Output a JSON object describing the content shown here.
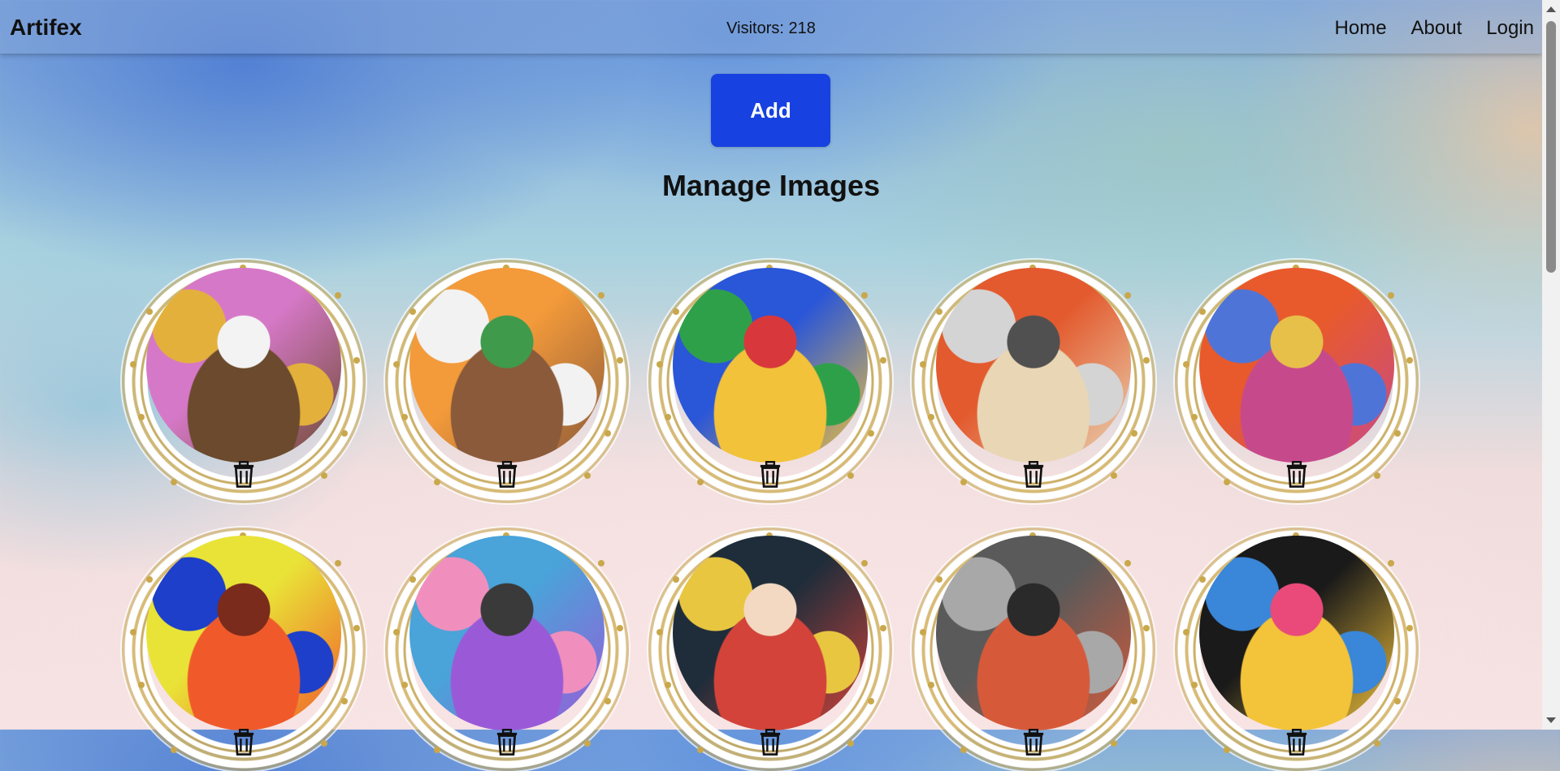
{
  "navbar": {
    "brand": "Artifex",
    "visitors": "Visitors: 218",
    "links": [
      "Home",
      "About",
      "Login"
    ]
  },
  "actions": {
    "add_label": "Add"
  },
  "page": {
    "title": "Manage Images"
  },
  "gallery": {
    "items": [
      {
        "icon": "delete-icon",
        "palette": [
          "#d678c8",
          "#e3b13b",
          "#f3f3f3",
          "#6b4a2d"
        ]
      },
      {
        "icon": "delete-icon",
        "palette": [
          "#f39a3a",
          "#f2f2f2",
          "#3f9a4c",
          "#8a5a3a"
        ]
      },
      {
        "icon": "delete-icon",
        "palette": [
          "#2a56d8",
          "#2fa04a",
          "#d8383b",
          "#f2c23a"
        ]
      },
      {
        "icon": "delete-icon",
        "palette": [
          "#e35a2e",
          "#d4d4d4",
          "#505050",
          "#e9d6b5"
        ]
      },
      {
        "icon": "delete-icon",
        "palette": [
          "#e85a2c",
          "#4f74d8",
          "#e7c04a",
          "#c64a8b"
        ]
      },
      {
        "icon": "delete-icon",
        "palette": [
          "#e9e337",
          "#1e3fc9",
          "#7a2b1c",
          "#f05a2a"
        ]
      },
      {
        "icon": "delete-icon",
        "palette": [
          "#4aa3d9",
          "#f08fbd",
          "#3a3a3a",
          "#9a5ad8"
        ]
      },
      {
        "icon": "delete-icon",
        "palette": [
          "#1f2d3a",
          "#e9c640",
          "#f3d9c2",
          "#d3433a"
        ]
      },
      {
        "icon": "delete-icon",
        "palette": [
          "#5a5a5a",
          "#a8a8a8",
          "#2a2a2a",
          "#d65a3a"
        ]
      },
      {
        "icon": "delete-icon",
        "palette": [
          "#1a1a1a",
          "#3a86d8",
          "#e94a7a",
          "#f3c33a"
        ]
      }
    ]
  }
}
